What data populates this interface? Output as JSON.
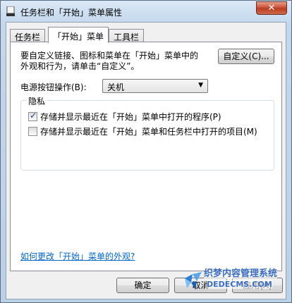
{
  "window": {
    "title": "任务栏和「开始」菜单属性",
    "close_glyph": "✕"
  },
  "tabs": [
    {
      "label": "任务栏",
      "active": false
    },
    {
      "label": "「开始」菜单",
      "active": true
    },
    {
      "label": "工具栏",
      "active": false
    }
  ],
  "start_menu": {
    "customize_desc_line1": "要自定义链接、图标和菜单在「开始」菜单中的",
    "customize_desc_line2": "外观和行为，请单击“自定义”。",
    "customize_button": "自定义(C)...",
    "power_label": "电源按钮操作(B):",
    "power_value": "关机",
    "privacy": {
      "title": "隐私",
      "items": [
        {
          "label": "存储并显示最近在「开始」菜单中打开的程序(P)",
          "checked": true
        },
        {
          "label": "存储并显示最近在「开始」菜单和任务栏中打开的项目(M)",
          "checked": false
        }
      ]
    },
    "help_link": "如何更改「开始」菜单的外观?"
  },
  "footer": {
    "ok_button": "确定",
    "cancel_button": "取消",
    "apply_button": "应用(A)"
  },
  "watermark": {
    "line1": "织梦内容管理系统",
    "line2": "DEDECMS.COM"
  }
}
